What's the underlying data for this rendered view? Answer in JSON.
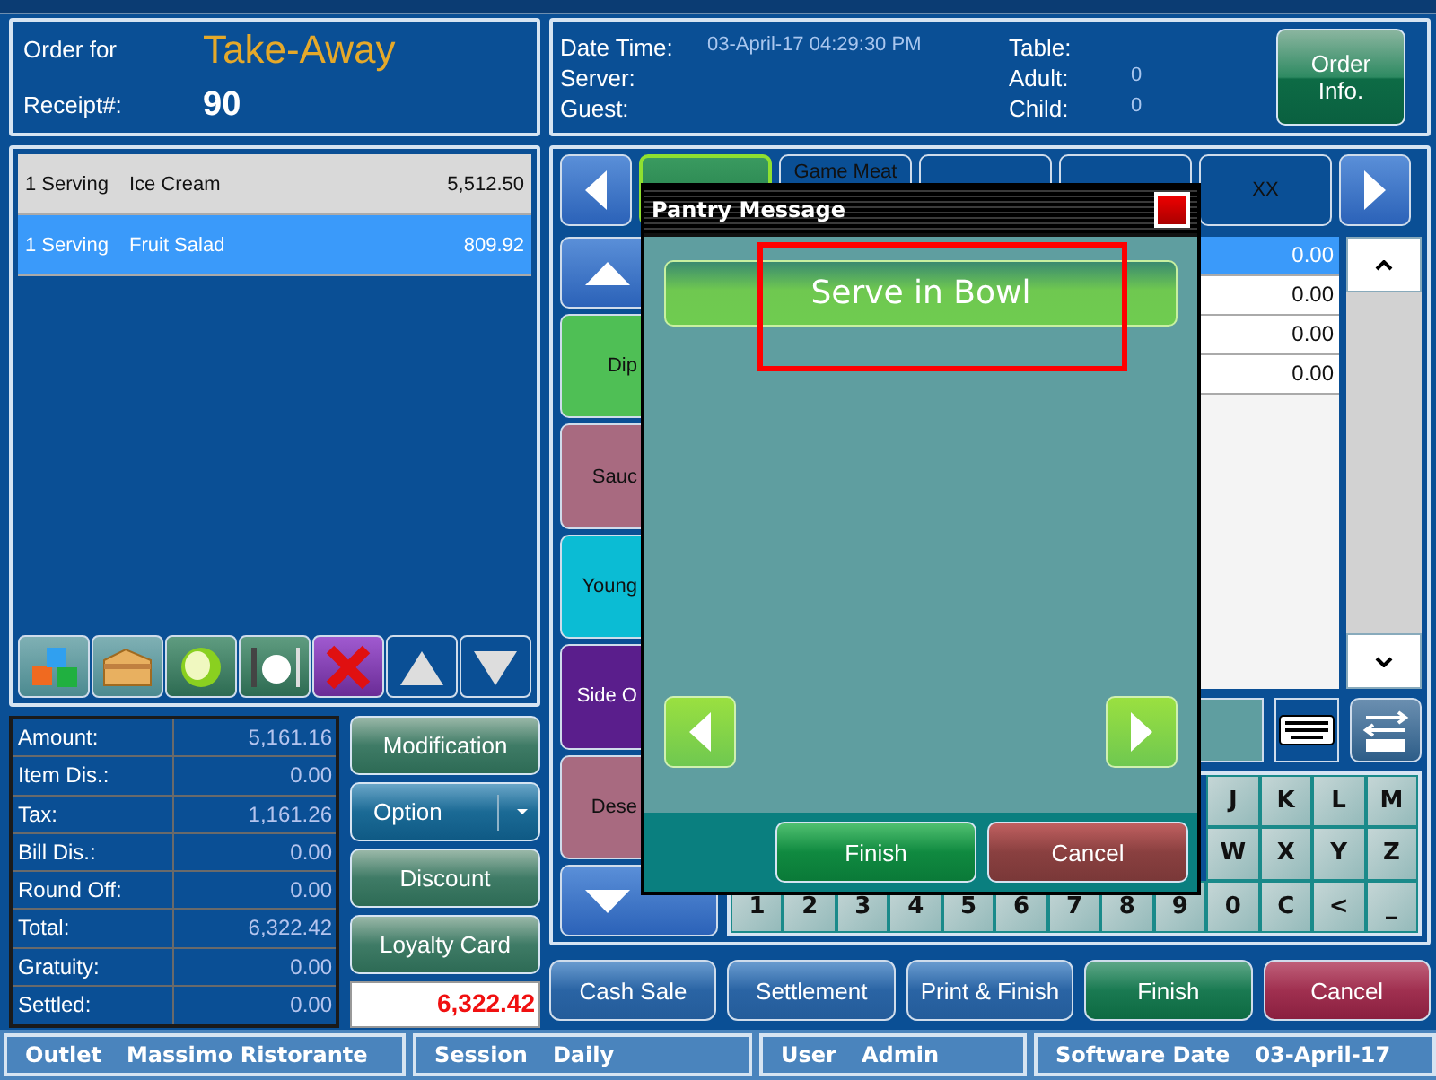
{
  "order_header": {
    "order_for_label": "Order for",
    "order_type": "Take-Away",
    "receipt_label": "Receipt#:",
    "receipt_number": "90"
  },
  "order_info": {
    "left": [
      {
        "label": "Date Time:",
        "value": "03-April-17 04:29:30 PM"
      },
      {
        "label": "Server:"
      },
      {
        "label": "Guest:"
      }
    ],
    "right": [
      {
        "label": "Table:"
      },
      {
        "label": "Adult:",
        "value": "0"
      },
      {
        "label": "Child:",
        "value": "0"
      }
    ],
    "button": "Order Info."
  },
  "order_items": [
    {
      "qty": "1 Serving",
      "name": "Ice Cream",
      "amount": "5,512.50",
      "selected": false
    },
    {
      "qty": "1 Serving",
      "name": "Fruit Salad",
      "amount": "809.92",
      "selected": true
    }
  ],
  "toolbar": [
    {
      "kind": "cubes"
    },
    {
      "kind": "box"
    },
    {
      "kind": "lime"
    },
    {
      "kind": "cutlery"
    },
    {
      "kind": "delete"
    },
    {
      "kind": "up"
    },
    {
      "kind": "down"
    }
  ],
  "totals": [
    {
      "label": "Amount:",
      "value": "5,161.16"
    },
    {
      "label": "Item Dis.:",
      "value": "0.00"
    },
    {
      "label": "Tax:",
      "value": "1,161.26"
    },
    {
      "label": "Bill Dis.:",
      "value": "0.00"
    },
    {
      "label": "Round Off:",
      "value": "0.00"
    },
    {
      "label": "Total:",
      "value": "6,322.42"
    },
    {
      "label": "Gratuity:",
      "value": "0.00"
    },
    {
      "label": "Settled:",
      "value": "0.00"
    }
  ],
  "side_buttons": [
    {
      "label": "Modification",
      "kind": "plain"
    },
    {
      "label": "Option",
      "kind": "dropdown"
    },
    {
      "label": "Discount",
      "kind": "plain"
    },
    {
      "label": "Loyalty Card",
      "kind": "plain"
    }
  ],
  "grand_total": "6,322.42",
  "category_tabs": [
    {
      "selected": true
    },
    {
      "label": "Game Meat",
      "selected": false
    },
    {
      "selected": false
    },
    {
      "selected": false
    },
    {
      "label": "XX",
      "selected": false
    }
  ],
  "categories": [
    {
      "label": "Dip",
      "color": "#4fbf55"
    },
    {
      "label": "Sauc",
      "color": "#a86a80"
    },
    {
      "label": "Young",
      "color": "#0bbcd4"
    },
    {
      "label": "Side O",
      "color": "#5a1e8c"
    },
    {
      "label": "Dese",
      "color": "#a86a80"
    }
  ],
  "item_prices": [
    {
      "value": "0.00",
      "selected": true
    },
    {
      "value": "0.00",
      "selected": false
    },
    {
      "value": "0.00",
      "selected": false
    },
    {
      "value": "0.00",
      "selected": false
    }
  ],
  "keyboard": [
    [
      "J",
      "K",
      "L",
      "M"
    ],
    [
      "W",
      "X",
      "Y",
      "Z"
    ],
    [
      "1",
      "2",
      "3",
      "4",
      "5",
      "6",
      "7",
      "8",
      "9",
      "0",
      "C",
      "<",
      "_"
    ]
  ],
  "actions": [
    {
      "label": "Cash Sale",
      "kind": "blue"
    },
    {
      "label": "Settlement",
      "kind": "blue"
    },
    {
      "label": "Print & Finish",
      "kind": "blue"
    },
    {
      "label": "Finish",
      "kind": "green"
    },
    {
      "label": "Cancel",
      "kind": "red"
    }
  ],
  "dialog": {
    "title": "Pantry Message",
    "options": [
      {
        "label": "Serve in Bowl"
      }
    ],
    "highlight": true,
    "buttons": [
      {
        "label": "Finish",
        "kind": "green"
      },
      {
        "label": "Cancel",
        "kind": "red"
      }
    ]
  },
  "status_bar": [
    {
      "label": "Outlet",
      "value": "Massimo Ristorante"
    },
    {
      "label": "Session",
      "value": "Daily"
    },
    {
      "label": "User",
      "value": "Admin"
    },
    {
      "label": "Software Date",
      "value": "03-April-17"
    }
  ]
}
